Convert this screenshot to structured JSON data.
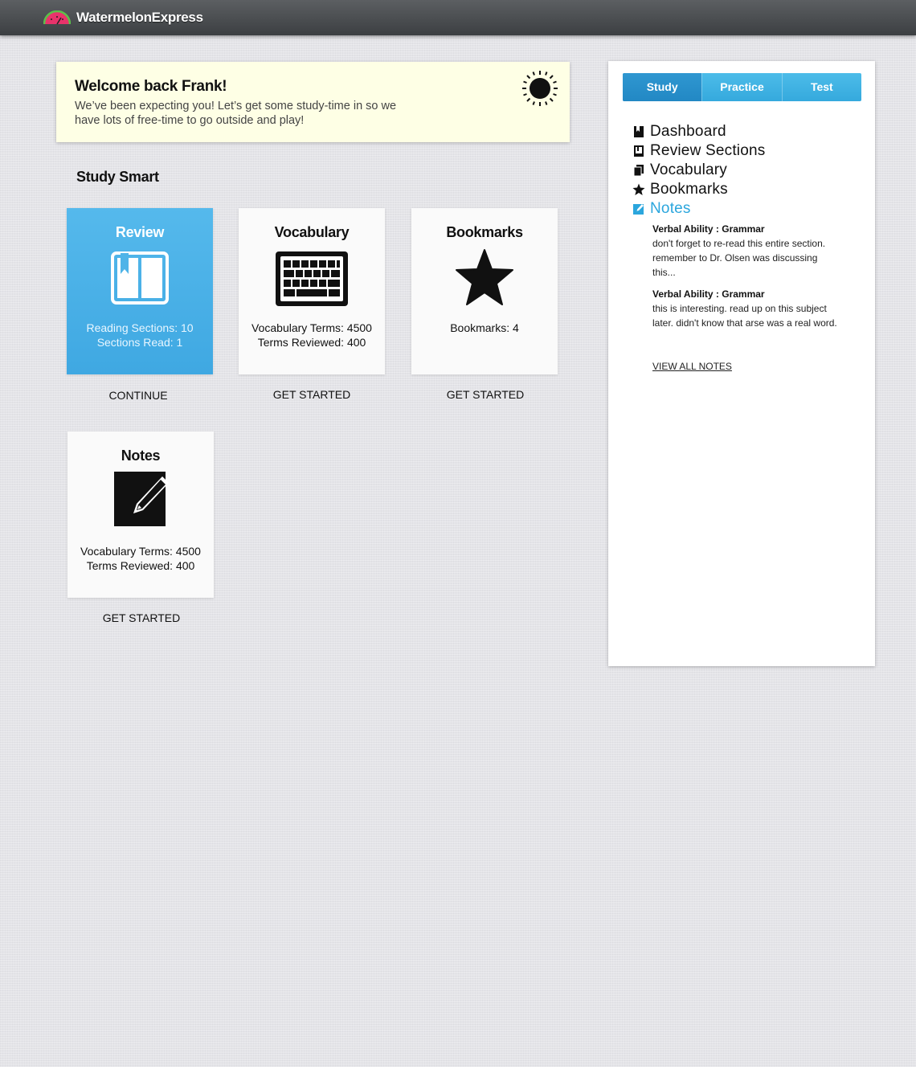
{
  "header": {
    "brand": "WatermelonExpress"
  },
  "welcome": {
    "title": "Welcome back Frank!",
    "body": "We’ve been expecting you! Let’s get some study-time in so we have lots of free-time to go outside and play!"
  },
  "main": {
    "section_title": "Study Smart",
    "cards": [
      {
        "title": "Review",
        "stat1": "Reading Sections: 10",
        "stat2": "Sections Read: 1",
        "link": "CONTINUE",
        "icon": "book-icon"
      },
      {
        "title": "Vocabulary",
        "stat1": "Vocabulary Terms: 4500",
        "stat2": "Terms Reviewed: 400",
        "link": "GET STARTED",
        "icon": "keyboard-icon"
      },
      {
        "title": "Bookmarks",
        "stat1": "Bookmarks: 4",
        "stat2": "",
        "link": "GET STARTED",
        "icon": "star-icon"
      },
      {
        "title": "Notes",
        "stat1": "Vocabulary Terms: 4500",
        "stat2": "Terms Reviewed: 400",
        "link": "GET STARTED",
        "icon": "edit-note-icon"
      }
    ]
  },
  "sidebar": {
    "tabs": [
      "Study",
      "Practice",
      "Test"
    ],
    "nav": [
      "Dashboard",
      "Review Sections",
      "Vocabulary",
      "Bookmarks",
      "Notes"
    ],
    "notes": [
      {
        "title": "Verbal Ability : Grammar",
        "body": "don't forget to re-read this entire section. remember to Dr. Olsen was discussing this..."
      },
      {
        "title": "Verbal Ability : Grammar",
        "body": "this is interesting. read up on this subject later. didn't know that arse was a real word."
      }
    ],
    "view_all": "VIEW ALL NOTES"
  },
  "colors": {
    "accent": "#3fa8e2",
    "active_nav": "#2ba6dd",
    "welcome_bg": "#feffe5"
  }
}
